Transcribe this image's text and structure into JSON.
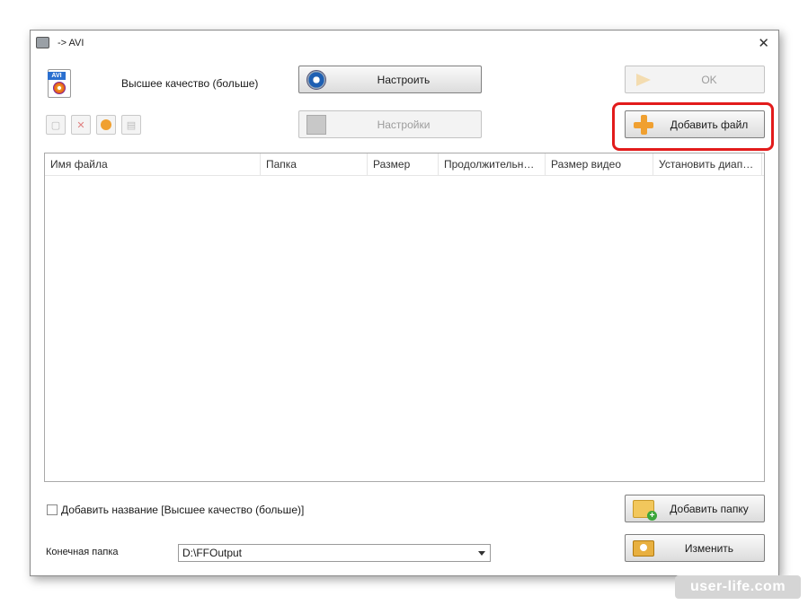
{
  "window": {
    "title": "-> AVI"
  },
  "format": {
    "icon_tag": "AVI",
    "quality": "Высшее качество (больше)"
  },
  "buttons": {
    "configure": "Настроить",
    "ok": "OK",
    "settings": "Настройки",
    "add_file": "Добавить файл",
    "add_folder": "Добавить папку",
    "change": "Изменить"
  },
  "file_list": {
    "columns": [
      "Имя файла",
      "Папка",
      "Размер",
      "Продолжительность",
      "Размер видео",
      "Установить диапаз..."
    ],
    "rows": []
  },
  "options": {
    "add_name_label": "Добавить название [Высшее качество (больше)]",
    "add_name_checked": false
  },
  "destination": {
    "label": "Конечная папка",
    "value": "D:\\FFOutput"
  },
  "watermark": "user-life.com",
  "colors": {
    "highlight": "#e21b1b",
    "accent_orange": "#f0a030"
  }
}
